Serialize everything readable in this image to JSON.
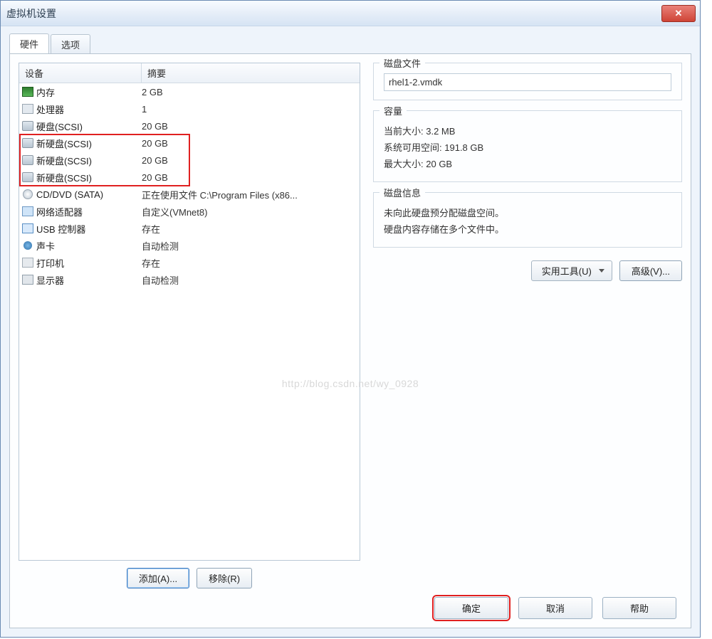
{
  "window": {
    "title": "虚拟机设置"
  },
  "tabs": {
    "hardware": "硬件",
    "options": "选项"
  },
  "device_list": {
    "headers": {
      "device": "设备",
      "summary": "摘要"
    },
    "rows": [
      {
        "icon": "mem",
        "name": "内存",
        "summary": "2 GB"
      },
      {
        "icon": "cpu",
        "name": "处理器",
        "summary": "1"
      },
      {
        "icon": "disk",
        "name": "硬盘(SCSI)",
        "summary": "20 GB"
      },
      {
        "icon": "disk",
        "name": "新硬盘(SCSI)",
        "summary": "20 GB"
      },
      {
        "icon": "disk",
        "name": "新硬盘(SCSI)",
        "summary": "20 GB"
      },
      {
        "icon": "disk",
        "name": "新硬盘(SCSI)",
        "summary": "20 GB"
      },
      {
        "icon": "cd",
        "name": "CD/DVD (SATA)",
        "summary": "正在使用文件 C:\\Program Files (x86..."
      },
      {
        "icon": "net",
        "name": "网络适配器",
        "summary": "自定义(VMnet8)"
      },
      {
        "icon": "usb",
        "name": "USB 控制器",
        "summary": "存在"
      },
      {
        "icon": "snd",
        "name": "声卡",
        "summary": "自动检测"
      },
      {
        "icon": "prn",
        "name": "打印机",
        "summary": "存在"
      },
      {
        "icon": "disp",
        "name": "显示器",
        "summary": "自动检测"
      }
    ]
  },
  "left_buttons": {
    "add": "添加(A)...",
    "remove": "移除(R)"
  },
  "right": {
    "disk_file": {
      "legend": "磁盘文件",
      "value": "rhel1-2.vmdk"
    },
    "capacity": {
      "legend": "容量",
      "current_label": "当前大小:",
      "current_value": "3.2 MB",
      "free_label": "系统可用空间:",
      "free_value": "191.8 GB",
      "max_label": "最大大小:",
      "max_value": "20 GB"
    },
    "disk_info": {
      "legend": "磁盘信息",
      "line1": "未向此硬盘预分配磁盘空间。",
      "line2": "硬盘内容存储在多个文件中。"
    },
    "utility_btn": "实用工具(U)",
    "advanced_btn": "高级(V)..."
  },
  "dialog_buttons": {
    "ok": "确定",
    "cancel": "取消",
    "help": "帮助"
  },
  "watermark": "http://blog.csdn.net/wy_0928"
}
